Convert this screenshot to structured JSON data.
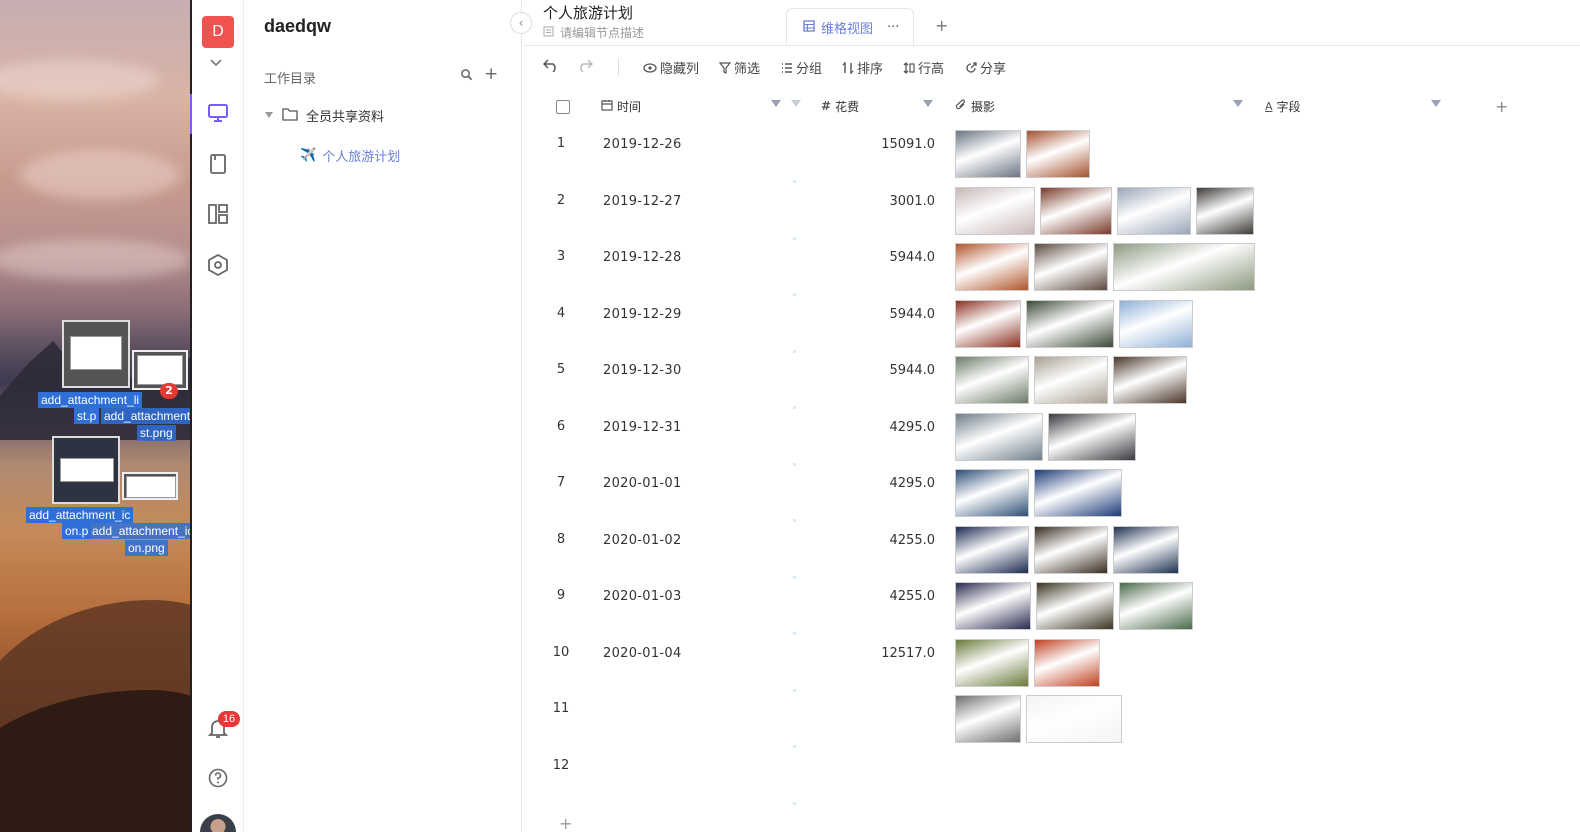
{
  "desktop": {
    "drag_badge_count": "2",
    "files": [
      {
        "line1": "add_attachment_li",
        "line2": "st.p",
        "line3": "add_attachment_li",
        "line4": "st.png"
      },
      {
        "line1": "add_attachment_ic",
        "line2": "on.p",
        "line3": "add_attachment_ic",
        "line4": "on.png"
      }
    ]
  },
  "rail": {
    "user_initial": "D",
    "notification_count": "16",
    "icons": [
      "monitor-icon",
      "book-icon",
      "layout-icon",
      "hexagon-icon",
      "bell-icon",
      "help-icon"
    ]
  },
  "sidebar": {
    "workspace_name": "daedqw",
    "directory_label": "工作目录",
    "tree": {
      "folder_label": "全员共享资料",
      "doc_label": "个人旅游计划"
    }
  },
  "document": {
    "title": "个人旅游计划",
    "description_placeholder": "请编辑节点描述",
    "active_view": "维格视图",
    "view_more": "···",
    "add_view": "+"
  },
  "toolbar": {
    "hide_columns": "隐藏列",
    "filter": "筛选",
    "group": "分组",
    "sort": "排序",
    "row_height": "行高",
    "share": "分享"
  },
  "columns": [
    {
      "name": "时间",
      "type_icon": "calendar-icon"
    },
    {
      "name": "花费",
      "type_icon": "number-icon"
    },
    {
      "name": "摄影",
      "type_icon": "attachment-icon"
    },
    {
      "name": "字段",
      "type_icon": "text-icon"
    }
  ],
  "add_column": "+",
  "add_row": "+",
  "rows": [
    {
      "no": "1",
      "date": "2019-12-26",
      "cost": "15091.0"
    },
    {
      "no": "2",
      "date": "2019-12-27",
      "cost": "3001.0"
    },
    {
      "no": "3",
      "date": "2019-12-28",
      "cost": "5944.0"
    },
    {
      "no": "4",
      "date": "2019-12-29",
      "cost": "5944.0"
    },
    {
      "no": "5",
      "date": "2019-12-30",
      "cost": "5944.0"
    },
    {
      "no": "6",
      "date": "2019-12-31",
      "cost": "4295.0"
    },
    {
      "no": "7",
      "date": "2020-01-01",
      "cost": "4295.0"
    },
    {
      "no": "8",
      "date": "2020-01-02",
      "cost": "4255.0"
    },
    {
      "no": "9",
      "date": "2020-01-03",
      "cost": "4255.0"
    },
    {
      "no": "10",
      "date": "2020-01-04",
      "cost": "12517.0"
    },
    {
      "no": "11",
      "date": "",
      "cost": ""
    },
    {
      "no": "12",
      "date": "",
      "cost": ""
    }
  ],
  "photo_colors": {
    "1": [
      "#6b7584",
      "#a4512e"
    ],
    "2": [
      "#c9b8b8",
      "#7a3a2a",
      "#9aa6b8",
      "#3d3a36"
    ],
    "3": [
      "#b0552a",
      "#5e4a3e",
      "#8d9a80"
    ],
    "4": [
      "#8a3020",
      "#3d4a38",
      "#8fb0d6"
    ],
    "5": [
      "#6d7b68",
      "#a8a092",
      "#4a3628"
    ],
    "6": [
      "#6e7e8a",
      "#3a3a40"
    ],
    "7": [
      "#2c4d75",
      "#1d3a78"
    ],
    "8": [
      "#1b2a50",
      "#3a2d22",
      "#1e3150"
    ],
    "9": [
      "#2a2a50",
      "#3a3420",
      "#4a6a4a"
    ],
    "10": [
      "#6a7a3a",
      "#c04020"
    ],
    "11": [
      "#6f6f6f",
      "#f4f4f4"
    ]
  }
}
